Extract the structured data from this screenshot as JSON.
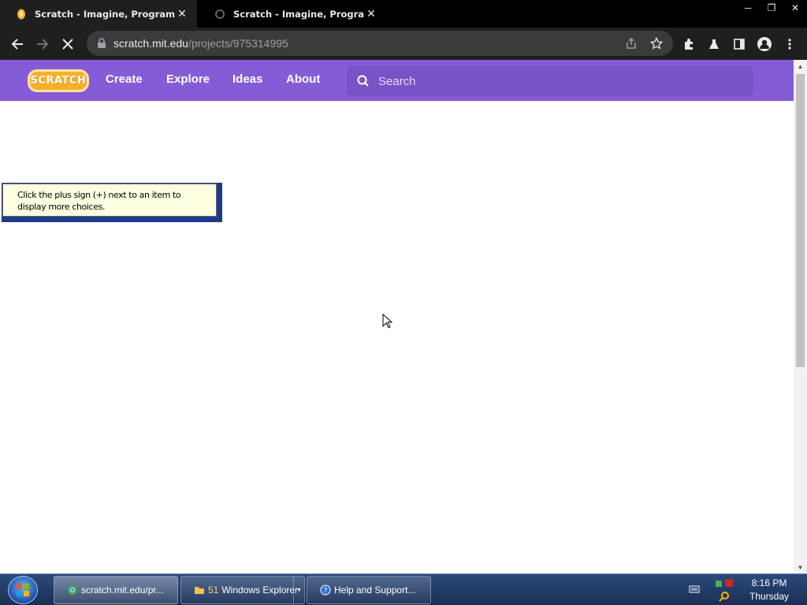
{
  "browser": {
    "tabs": [
      {
        "title": "Scratch - Imagine, Program, Share",
        "active": true
      },
      {
        "title": "Scratch - Imagine, Program, Share",
        "active": false
      }
    ],
    "url_host": "scratch.mit.edu",
    "url_path": "/projects/975314995"
  },
  "scratch": {
    "logo_text": "SCRATCH",
    "nav": [
      "Create",
      "Explore",
      "Ideas",
      "About"
    ],
    "search_placeholder": "Search",
    "brand_color": "#855cd6"
  },
  "tooltip": {
    "text": "Click the plus sign (+) next to an item to display more choices."
  },
  "taskbar": {
    "buttons": [
      {
        "label": "scratch.mit.edu/pr...",
        "icon": "chrome-icon"
      },
      {
        "count": "51",
        "label": "Windows Explorer",
        "icon": "folder-icon"
      },
      {
        "label": "Help and Support...",
        "icon": "help-icon"
      }
    ],
    "time": "8:16 PM",
    "day": "Thursday"
  }
}
